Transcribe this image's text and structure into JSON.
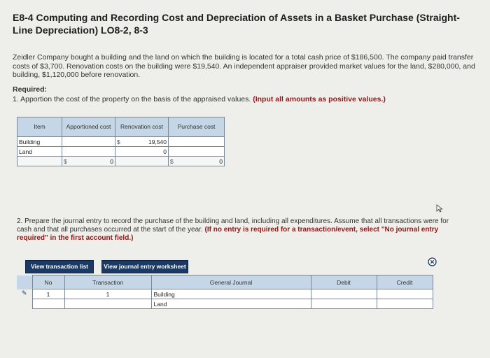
{
  "title": "E8-4 Computing and Recording Cost and Depreciation of Assets in a Basket Purchase (Straight-Line Depreciation) LO8-2, 8-3",
  "intro": "Zeidler Company bought a building and the land on which the building is located for a total cash price of $186,500. The company paid transfer costs of $3,700. Renovation costs on the building were $19,540. An independent appraiser provided market values for the land, $280,000, and building, $1,120,000 before renovation.",
  "required_heading": "Required:",
  "req1_text": "1. Apportion the cost of the property on the basis of the appraised values.",
  "req1_note": "(Input all amounts as positive values.)",
  "table1": {
    "headers": [
      "Item",
      "Apportioned cost",
      "Renovation cost",
      "Purchase cost"
    ],
    "rows": [
      {
        "item": "Building",
        "renovation": "19,540"
      },
      {
        "item": "Land",
        "renovation": "0"
      }
    ],
    "total": {
      "dollar": "$",
      "apportioned": "0",
      "purchase": "0"
    },
    "dollar": "$"
  },
  "q2_text": "2. Prepare the journal entry to record the purchase of the building and land, including all expenditures. Assume that all transactions were for cash and that all purchases occurred at the start of the year.",
  "q2_note": "(If no entry is required for a transaction/event, select \"No journal entry required\" in the first account field.)",
  "buttons": {
    "view_transaction_list": "View transaction list",
    "view_journal_worksheet": "View journal entry worksheet"
  },
  "table2": {
    "headers": [
      "No",
      "Transaction",
      "General Journal",
      "Debit",
      "Credit"
    ],
    "row": {
      "no": "1",
      "transaction": "1",
      "accounts": [
        "Building",
        "Land"
      ]
    }
  }
}
